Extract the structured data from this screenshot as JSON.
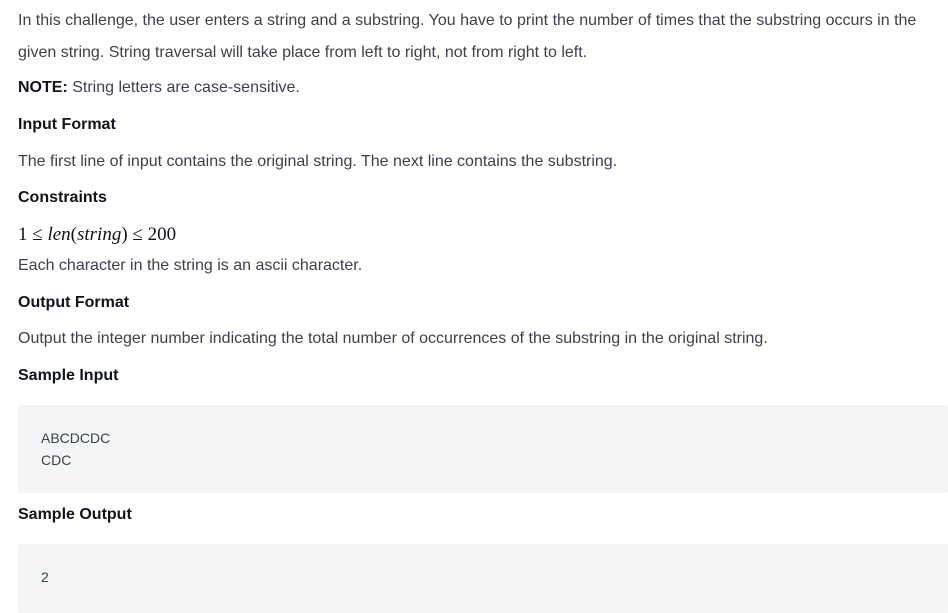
{
  "intro": "In this challenge, the user enters a string and a substring. You have to print the number of times that the substring occurs in the given string. String traversal will take place from left to right, not from right to left.",
  "note": {
    "label": "NOTE:",
    "text": " String letters are case-sensitive."
  },
  "input_format": {
    "heading": "Input Format",
    "text": "The first line of input contains the original string. The next line contains the substring."
  },
  "constraints": {
    "heading": "Constraints",
    "math": {
      "lhs": "1 ≤ ",
      "func": "len",
      "open": "(",
      "arg": "string",
      "close": ")",
      "rhs": " ≤ 200"
    },
    "text": "Each character in the string is an ascii character."
  },
  "output_format": {
    "heading": "Output Format",
    "text": "Output the integer number indicating the total number of occurrences of the substring in the original string."
  },
  "sample_input": {
    "heading": "Sample Input",
    "lines": [
      "ABCDCDC",
      "CDC"
    ]
  },
  "sample_output": {
    "heading": "Sample Output",
    "lines": [
      "2"
    ]
  }
}
